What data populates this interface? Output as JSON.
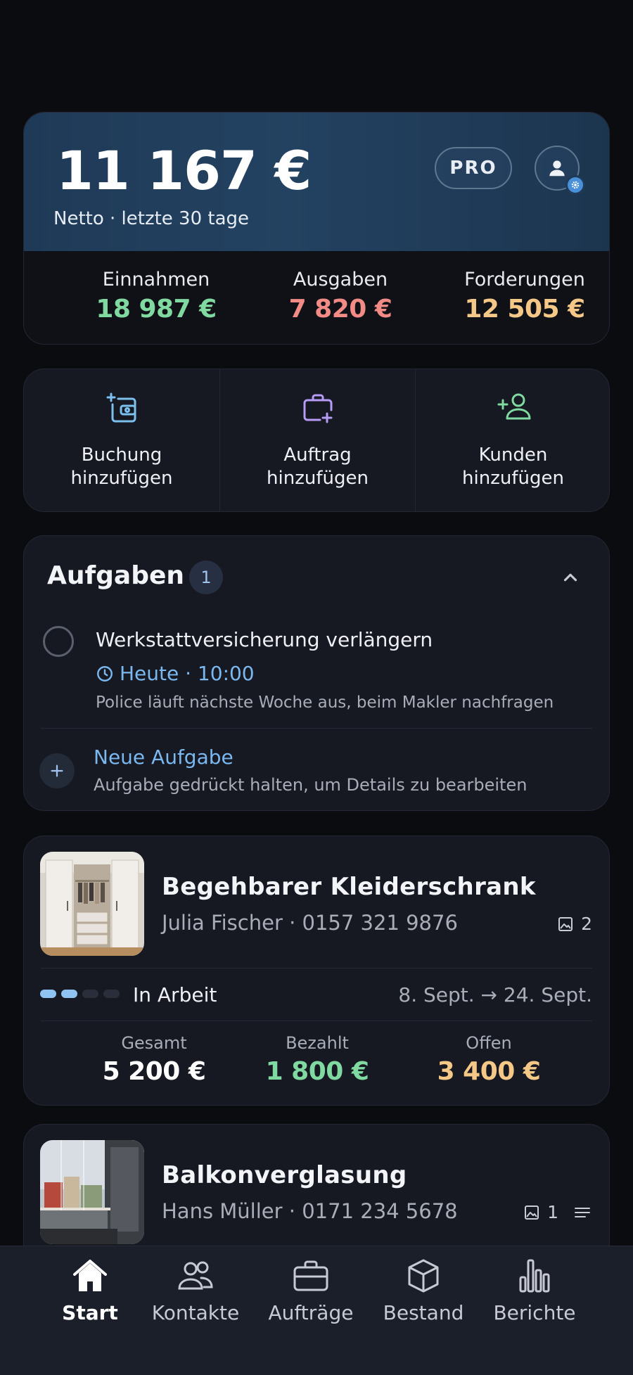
{
  "summary": {
    "net_amount": "11 167 €",
    "net_label": "Netto · letzte 30 tage",
    "pro_badge": "PRO",
    "stats": [
      {
        "label": "Einnahmen",
        "value": "18 987 €",
        "color": "#7fd9a0"
      },
      {
        "label": "Ausgaben",
        "value": "7 820 €",
        "color": "#f28a86"
      },
      {
        "label": "Forderungen",
        "value": "12 505 €",
        "color": "#f6c887"
      }
    ]
  },
  "actions": [
    {
      "line1": "Buchung",
      "line2": "hinzufügen",
      "icon": "booking-add-icon",
      "color": "#7cc0f0"
    },
    {
      "line1": "Auftrag",
      "line2": "hinzufügen",
      "icon": "briefcase-add-icon",
      "color": "#b79cf5"
    },
    {
      "line1": "Kunden",
      "line2": "hinzufügen",
      "icon": "user-add-icon",
      "color": "#7fd9a0"
    }
  ],
  "tasks": {
    "title": "Aufgaben",
    "count": "1",
    "items": [
      {
        "title": "Werkstattversicherung verlängern",
        "time": "Heute · 10:00",
        "note": "Police läuft nächste Woche aus, beim Makler nachfragen"
      }
    ],
    "new_task_label": "Neue Aufgabe",
    "new_task_hint": "Aufgabe gedrückt halten, um Details zu bearbeiten"
  },
  "jobs": [
    {
      "title": "Begehbarer Kleiderschrank",
      "customer": "Julia Fischer",
      "phone": "0157 321 9876",
      "contact": "Julia Fischer · 0157 321 9876",
      "photo_count": "2",
      "status": "In Arbeit",
      "progress_steps_done": 2,
      "progress_steps_total": 4,
      "dates": "8. Sept. → 24. Sept.",
      "totals": [
        {
          "label": "Gesamt",
          "value": "5 200 €",
          "color": "#ffffff"
        },
        {
          "label": "Bezahlt",
          "value": "1 800 €",
          "color": "#7fd9a0"
        },
        {
          "label": "Offen",
          "value": "3 400 €",
          "color": "#f6c887"
        }
      ]
    },
    {
      "title": "Balkonverglasung",
      "customer": "Hans Müller",
      "phone": "0171 234 5678",
      "contact": "Hans Müller · 0171 234 5678",
      "photo_count": "1"
    }
  ],
  "nav": [
    {
      "label": "Start",
      "icon": "home-icon",
      "active": true
    },
    {
      "label": "Kontakte",
      "icon": "contacts-icon",
      "active": false
    },
    {
      "label": "Aufträge",
      "icon": "briefcase-icon",
      "active": false
    },
    {
      "label": "Bestand",
      "icon": "box-icon",
      "active": false
    },
    {
      "label": "Berichte",
      "icon": "bar-chart-icon",
      "active": false
    }
  ]
}
